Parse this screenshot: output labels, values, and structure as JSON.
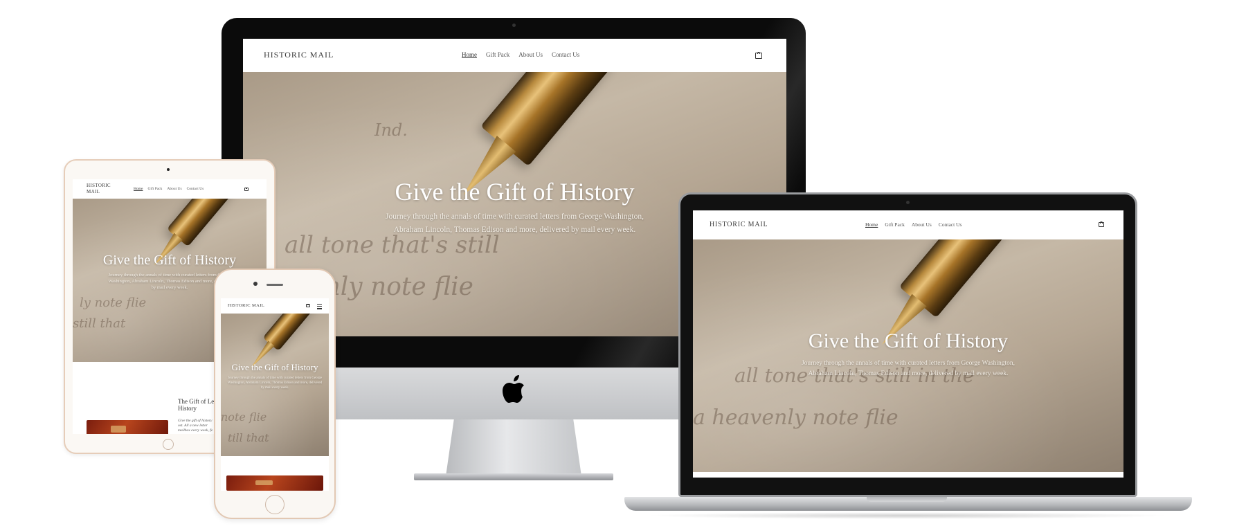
{
  "site": {
    "brand": "HISTORIC MAIL",
    "brand_line1": "HISTORIC",
    "brand_line2": "MAIL",
    "nav": [
      "Home",
      "Gift Pack",
      "About Us",
      "Contact Us"
    ],
    "hero_title": "Give the Gift of History",
    "hero_subtitle": "Journey through the annals of time with curated letters from George Washington, Abraham Lincoln, Thomas Edison and more, delivered by mail every week.",
    "hero_subtitle_line1": "Journey through the annals of time with curated letters from George Washington,",
    "hero_subtitle_line2": "Abraham Lincoln, Thomas Edison and more, delivered by mail every week.",
    "tablet_section_title": "The Gift of Letters from History",
    "tablet_section_title_visible": "The Gift of Le",
    "tablet_section_title_line2": "History",
    "tablet_section_text_line1": "Give the gift of history",
    "tablet_section_text_line2": "ost. All a new letter",
    "tablet_section_text_line3": "mailbox every week, fe"
  },
  "icons": {
    "cart": "shopping-bag-icon",
    "menu": "hamburger-menu-icon",
    "logo": "apple-logo-icon"
  },
  "colors": {
    "accent_gold": "#b88a3e",
    "paper": "#c5b8a6",
    "device_gold_trim": "#e6cdb9"
  }
}
